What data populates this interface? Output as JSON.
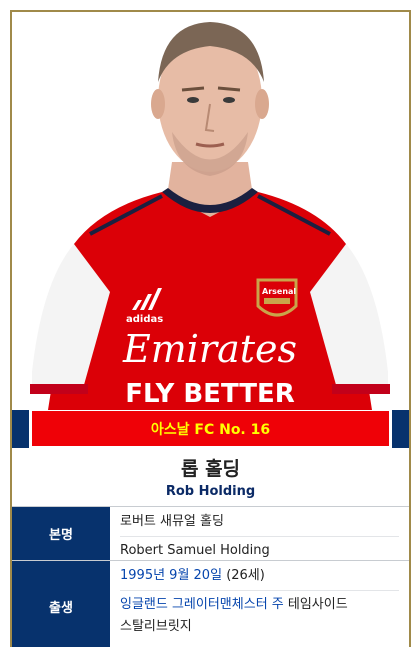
{
  "banner": {
    "club_text": "아스날 FC No. 16"
  },
  "player": {
    "name_ko": "롭 홀딩",
    "name_en": "Rob Holding"
  },
  "infobox": {
    "real_name_label": "본명",
    "real_name_ko": "로버트 새뮤얼 홀딩",
    "real_name_en": "Robert Samuel Holding",
    "birth_label": "출생",
    "birth_date_link": "1995년 9월 20일",
    "birth_age": "(26세)",
    "birth_place_link": "잉글랜드 그레이터맨체스터 주",
    "birth_place_rest_1": "테임사이드",
    "birth_place_rest_2": "스탈리브릿지"
  },
  "shirt": {
    "sponsor_line1": "Emirates",
    "sponsor_line2": "FLY BETTER",
    "brand": "adidas",
    "crest": "Arsenal"
  },
  "colors": {
    "navy": "#07326d",
    "arsenal_red": "#ef0107",
    "banner_number": "#ffff00",
    "border_gold": "#a08a4a",
    "link": "#0645ad"
  },
  "icons": [
    "player-photo",
    "adidas-logo-icon",
    "arsenal-crest-icon"
  ]
}
